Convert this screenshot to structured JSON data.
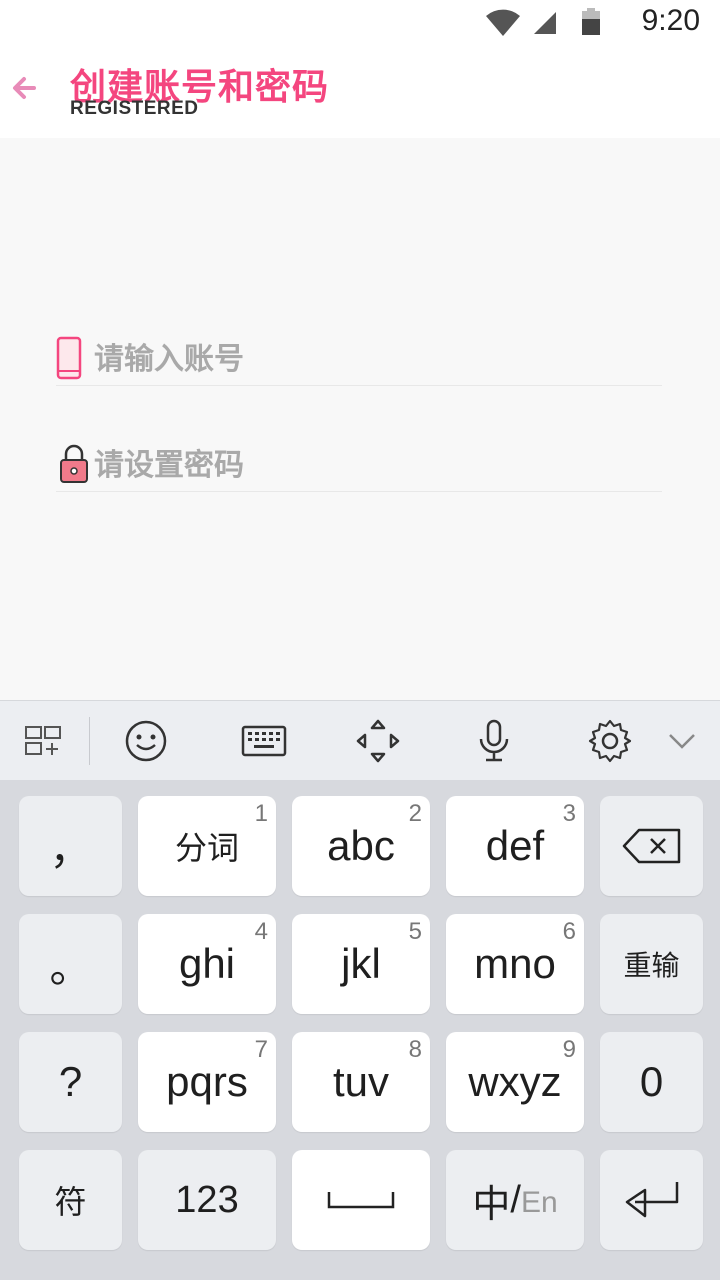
{
  "status": {
    "time": "9:20"
  },
  "header": {
    "title": "创建账号和密码",
    "subtitle": "REGISTERED"
  },
  "form": {
    "account_placeholder": "请输入账号",
    "password_placeholder": "请设置密码"
  },
  "colors": {
    "accent": "#f4467f",
    "icon_pink": "#f07a8a"
  },
  "keyboard": {
    "toolbar": [
      "apps-grid-icon",
      "emoji-icon",
      "keyboard-icon",
      "cursor-move-icon",
      "microphone-icon",
      "settings-icon",
      "collapse-chevron-icon"
    ],
    "keys": {
      "comma": "，",
      "period": "。",
      "question": "?",
      "symbols": "符",
      "k1": "分词",
      "n1": "1",
      "k2": "abc",
      "n2": "2",
      "k3": "def",
      "n3": "3",
      "k4": "ghi",
      "n4": "4",
      "k5": "jkl",
      "n5": "5",
      "k6": "mno",
      "n6": "6",
      "k7": "pqrs",
      "n7": "7",
      "k8": "tuv",
      "n8": "8",
      "k9": "wxyz",
      "n9": "9",
      "retype": "重输",
      "zero": "0",
      "numbers": "123",
      "lang_cn": "中",
      "lang_slash": "/",
      "lang_en": "En"
    }
  }
}
